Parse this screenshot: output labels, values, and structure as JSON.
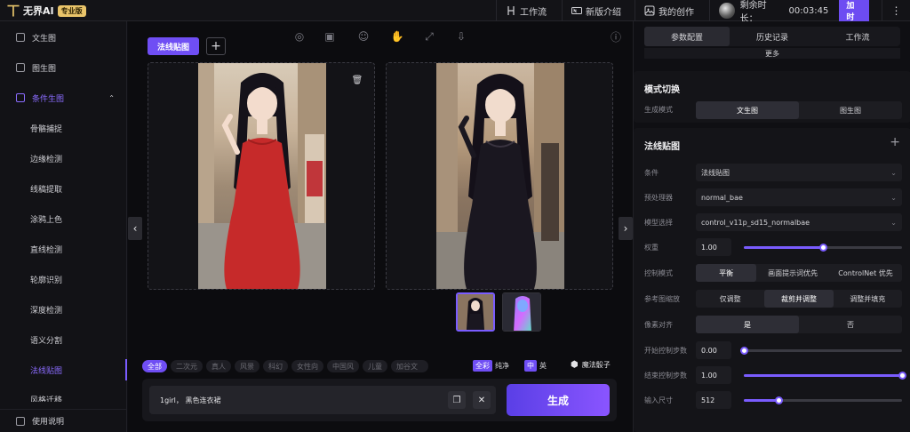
{
  "topbar": {
    "logo_mark": "丅",
    "logo_text": "无界AI",
    "edition_badge": "专业版",
    "nav": [
      {
        "label": "工作流",
        "icon": "workflow-icon"
      },
      {
        "label": "新版介绍",
        "icon": "new-badge-icon"
      },
      {
        "label": "我的创作",
        "icon": "image-icon"
      }
    ],
    "remaining_label": "剩余时长：",
    "remaining_time": "00:03:45",
    "add_time_button": "加时"
  },
  "sidebar": {
    "items": [
      {
        "label": "文生图"
      },
      {
        "label": "图生图"
      },
      {
        "label": "条件生图"
      }
    ],
    "sub_items": [
      "骨骼捕捉",
      "边缘检测",
      "线稿提取",
      "涂鸦上色",
      "直线检测",
      "轮廓识别",
      "深度检测",
      "语义分割",
      "法线贴图",
      "风格迁移"
    ],
    "active_sub": "法线贴图",
    "footer": "使用说明"
  },
  "main": {
    "tab_label": "法线贴图",
    "tools": [
      "palette-icon",
      "frame-icon",
      "face-icon",
      "hand-icon",
      "expand-icon",
      "download-icon"
    ],
    "style_chips": [
      "全部",
      "二次元",
      "真人",
      "风景",
      "科幻",
      "女性向",
      "中国风",
      "儿童",
      "加谷文"
    ],
    "active_chip": "全部",
    "lang_full": "全彩",
    "lang_pure": "纯净",
    "lang_zh": "中",
    "lang_en": "英",
    "magic_dice": "魔法骰子",
    "prompt_value": "1girl， 黑色连衣裙",
    "generate_button": "生成"
  },
  "right": {
    "tabs": [
      "参数配置",
      "历史记录",
      "工作流"
    ],
    "more_label": "更多",
    "mode_section_title": "模式切换",
    "mode_label": "生成模式",
    "mode_options": [
      "文生图",
      "图生图"
    ],
    "normal_section_title": "法线贴图",
    "condition_label": "条件",
    "condition_value": "法线贴图",
    "preprocessor_label": "预处理器",
    "preprocessor_value": "normal_bae",
    "model_label": "模型选择",
    "model_value": "control_v11p_sd15_normalbae",
    "weight_label": "权重",
    "weight_value": "1.00",
    "weight_fraction": 0.5,
    "control_mode_label": "控制模式",
    "control_mode_options": [
      "平衡",
      "画面提示词优先",
      "ControlNet 优先"
    ],
    "resize_label": "参考图缩放",
    "resize_options": [
      "仅调整",
      "裁剪并调整",
      "调整并填充"
    ],
    "pixel_label": "像素对齐",
    "pixel_options": [
      "是",
      "否"
    ],
    "start_label": "开始控制步数",
    "start_value": "0.00",
    "start_fraction": 0.0,
    "end_label": "结束控制步数",
    "end_value": "1.00",
    "end_fraction": 1.0,
    "input_size_label": "输入尺寸",
    "input_size_value": "512",
    "input_size_fraction": 0.22
  }
}
